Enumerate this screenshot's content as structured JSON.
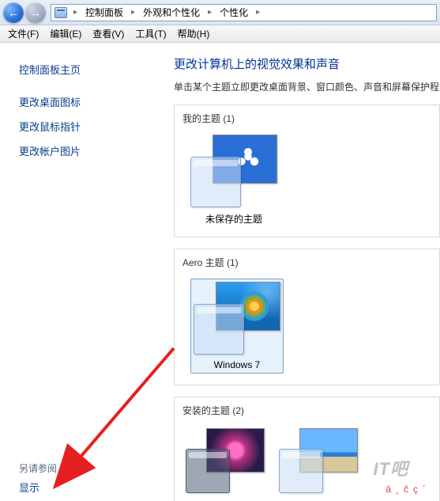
{
  "breadcrumb": {
    "items": [
      "控制面板",
      "外观和个性化",
      "个性化"
    ]
  },
  "menu": {
    "file": "文件(F)",
    "edit": "编辑(E)",
    "view": "查看(V)",
    "tools": "工具(T)",
    "help": "帮助(H)"
  },
  "sidebar": {
    "home": "控制面板主页",
    "links": [
      "更改桌面图标",
      "更改鼠标指针",
      "更改帐户图片"
    ],
    "see_also_label": "另请参阅",
    "see_also_link": "显示"
  },
  "content": {
    "heading": "更改计算机上的视觉效果和声音",
    "desc": "单击某个主题立即更改桌面背景、窗口颜色、声音和屏幕保护程",
    "my_themes_title": "我的主题 (1)",
    "my_theme_label": "未保存的主题",
    "aero_title": "Aero 主题 (1)",
    "aero_label": "Windows 7",
    "installed_title": "安装的主题 (2)"
  },
  "watermark": "IT吧",
  "footer_glyphs": "ä¸čç´"
}
